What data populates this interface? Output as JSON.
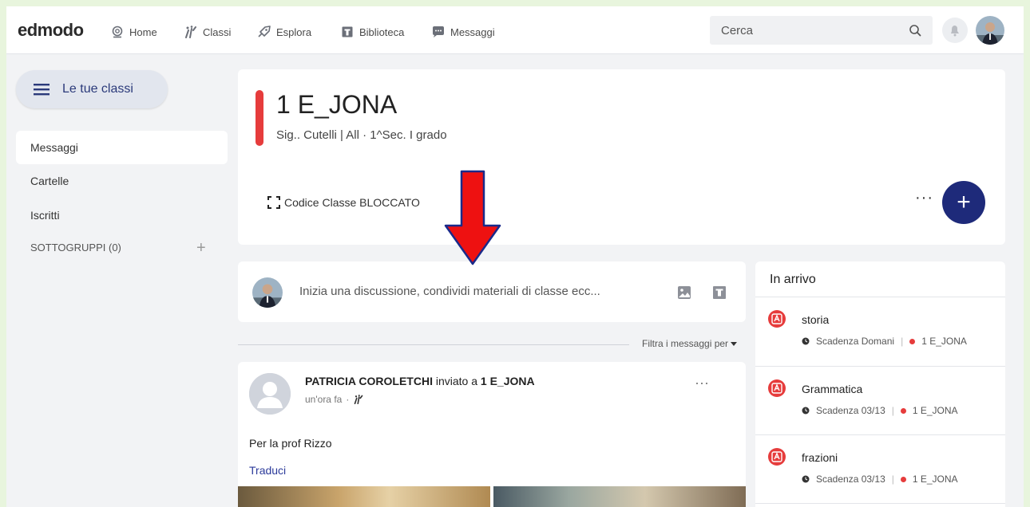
{
  "nav": {
    "logo": "edmodo",
    "links": [
      "Home",
      "Classi",
      "Esplora",
      "Biblioteca",
      "Messaggi"
    ],
    "search_placeholder": "Cerca"
  },
  "sidebar": {
    "classes_button": "Le tue classi",
    "items": [
      "Messaggi",
      "Cartelle",
      "Iscritti"
    ],
    "subgroups": "SOTTOGRUPPI (0)"
  },
  "header": {
    "title": "1 E_JONA",
    "subtitle": "Sig.. Cutelli | All  · 1^Sec. I grado",
    "code": "Codice Classe BLOCCATO",
    "more": "···",
    "add": "+"
  },
  "composer": {
    "placeholder": "Inizia una discussione, condividi materiali di classe ecc..."
  },
  "filter": "Filtra i messaggi per",
  "post": {
    "author": "PATRICIA COROLETCHI",
    "sent_to": "inviato a",
    "target": "1 E_JONA",
    "time": "un'ora fa",
    "body": "Per la prof Rizzo",
    "translate": "Traduci",
    "more": "···"
  },
  "incoming": {
    "title": "In arrivo",
    "items": [
      {
        "name": "storia",
        "due": "Scadenza Domani",
        "class": "1 E_JONA"
      },
      {
        "name": "Grammatica",
        "due": "Scadenza 03/13",
        "class": "1 E_JONA"
      },
      {
        "name": "frazioni",
        "due": "Scadenza 03/13",
        "class": "1 E_JONA"
      }
    ]
  },
  "colors": {
    "accent": "#1e2a7a",
    "red": "#e63c3c",
    "outer_background": "#e8f5dd"
  }
}
